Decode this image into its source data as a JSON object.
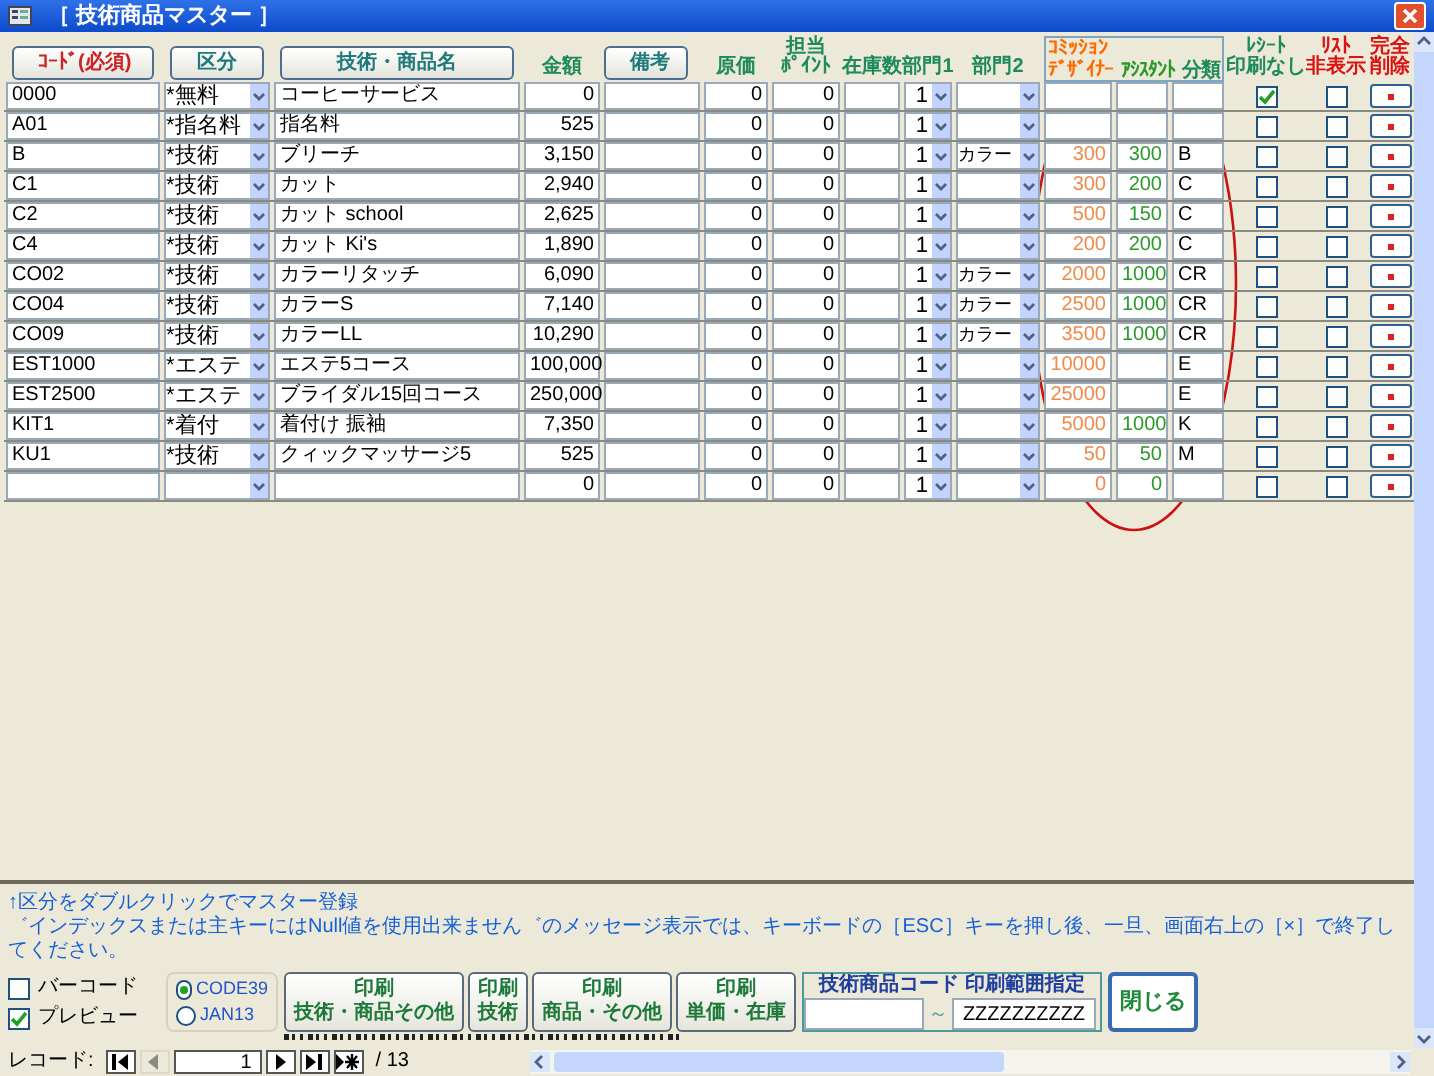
{
  "window": {
    "title": "［ 技術商品マスター ］"
  },
  "columns": [
    {
      "kind": "button",
      "lines": [
        "ｺｰﾄﾞ(必須)"
      ],
      "color": "#cc2222"
    },
    {
      "kind": "button",
      "lines": [
        "区分"
      ],
      "color": "#1f7a7a"
    },
    {
      "kind": "button",
      "lines": [
        "技術・商品名"
      ],
      "color": "#1f7a7a"
    },
    {
      "kind": "label",
      "lines": [
        "金額"
      ],
      "color": "#1f8a5a"
    },
    {
      "kind": "button",
      "lines": [
        "備考"
      ],
      "color": "#1f7a7a"
    },
    {
      "kind": "label",
      "lines": [
        "原価"
      ],
      "color": "#1f8a5a"
    },
    {
      "kind": "label",
      "lines": [
        "担当",
        "ﾎﾟｲﾝﾄ"
      ],
      "color": "#1f8a5a"
    },
    {
      "kind": "label",
      "lines": [
        "在庫数"
      ],
      "color": "#1f8a5a"
    },
    {
      "kind": "label",
      "lines": [
        "部門1"
      ],
      "color": "#1f8a5a"
    },
    {
      "kind": "label",
      "lines": [
        "部門2"
      ],
      "color": "#1f8a5a"
    },
    {
      "kind": "group",
      "lines": [
        "ｺﾐｯｼｮﾝ"
      ],
      "color": "#ff6a00",
      "children": [
        {
          "label": "ﾃﾞｻﾞｲﾅｰ",
          "color": "#ff6a00"
        },
        {
          "label": "ｱｼｽﾀﾝﾄ",
          "color": "#2a9a2a"
        },
        {
          "label": "分類",
          "color": "#1f8a5a"
        }
      ]
    },
    {
      "kind": "label",
      "lines": [
        "ﾚｼｰﾄ",
        "印刷なし"
      ],
      "color": "#1f8a5a"
    },
    {
      "kind": "label",
      "lines": [
        "ﾘｽﾄ",
        "非表示"
      ],
      "color": "#dd1111"
    },
    {
      "kind": "label",
      "lines": [
        "完全",
        "削除"
      ],
      "color": "#dd1111"
    }
  ],
  "rows": [
    {
      "code": "0000",
      "category": "*無料",
      "name": "コーヒーサービス",
      "amount": "0",
      "cost": "0",
      "points": "0",
      "dept1": "1",
      "no_receipt": true,
      "list_hidden": false
    },
    {
      "code": "A01",
      "category": "*指名料",
      "name": "指名料",
      "amount": "525",
      "cost": "0",
      "points": "0",
      "dept1": "1",
      "no_receipt": false,
      "list_hidden": false
    },
    {
      "code": "B",
      "category": "*技術",
      "name": "ブリーチ",
      "amount": "3,150",
      "cost": "0",
      "points": "0",
      "dept1": "1",
      "dept2": "カラー",
      "designer": "300",
      "assistant": "300",
      "class": "B",
      "no_receipt": false,
      "list_hidden": false
    },
    {
      "code": "C1",
      "category": "*技術",
      "name": "カット",
      "amount": "2,940",
      "cost": "0",
      "points": "0",
      "dept1": "1",
      "designer": "300",
      "assistant": "200",
      "class": "C",
      "no_receipt": false,
      "list_hidden": false
    },
    {
      "code": "C2",
      "category": "*技術",
      "name": "カット school",
      "amount": "2,625",
      "cost": "0",
      "points": "0",
      "dept1": "1",
      "designer": "500",
      "assistant": "150",
      "class": "C",
      "no_receipt": false,
      "list_hidden": false
    },
    {
      "code": "C4",
      "category": "*技術",
      "name": "カット Ki's",
      "amount": "1,890",
      "cost": "0",
      "points": "0",
      "dept1": "1",
      "designer": "200",
      "assistant": "200",
      "class": "C",
      "no_receipt": false,
      "list_hidden": false
    },
    {
      "code": "CO02",
      "category": "*技術",
      "name": "カラーリタッチ",
      "amount": "6,090",
      "cost": "0",
      "points": "0",
      "dept1": "1",
      "dept2": "カラー",
      "designer": "2000",
      "assistant": "1000",
      "class": "CR",
      "no_receipt": false,
      "list_hidden": false
    },
    {
      "code": "CO04",
      "category": "*技術",
      "name": "カラーS",
      "amount": "7,140",
      "cost": "0",
      "points": "0",
      "dept1": "1",
      "dept2": "カラー",
      "designer": "2500",
      "assistant": "1000",
      "class": "CR",
      "no_receipt": false,
      "list_hidden": false
    },
    {
      "code": "CO09",
      "category": "*技術",
      "name": "カラーLL",
      "amount": "10,290",
      "cost": "0",
      "points": "0",
      "dept1": "1",
      "dept2": "カラー",
      "designer": "3500",
      "assistant": "1000",
      "class": "CR",
      "no_receipt": false,
      "list_hidden": false
    },
    {
      "code": "EST1000",
      "category": "*エステ",
      "name": "エステ5コース",
      "amount": "100,000",
      "cost": "0",
      "points": "0",
      "dept1": "1",
      "designer": "10000",
      "class": "E",
      "no_receipt": false,
      "list_hidden": false
    },
    {
      "code": "EST2500",
      "category": "*エステ",
      "name": "ブライダル15回コース",
      "amount": "250,000",
      "cost": "0",
      "points": "0",
      "dept1": "1",
      "designer": "25000",
      "class": "E",
      "no_receipt": false,
      "list_hidden": false
    },
    {
      "code": "KIT1",
      "category": "*着付",
      "name": "着付け 振袖",
      "amount": "7,350",
      "cost": "0",
      "points": "0",
      "dept1": "1",
      "designer": "5000",
      "assistant": "1000",
      "class": "K",
      "no_receipt": false,
      "list_hidden": false
    },
    {
      "code": "KU1",
      "category": "*技術",
      "name": "クィックマッサージ5",
      "amount": "525",
      "cost": "0",
      "points": "0",
      "dept1": "1",
      "designer": "50",
      "assistant": "50",
      "class": "M",
      "no_receipt": false,
      "list_hidden": false
    },
    {
      "amount": "0",
      "cost": "0",
      "points": "0",
      "dept1": "1",
      "designer": "0",
      "assistant": "0",
      "no_receipt": false,
      "list_hidden": false
    }
  ],
  "hint": "↑区分をダブルクリックでマスター登録",
  "note": "゛インデックスまたは主キーにはNull値を使用出来ません゛のメッセージ表示では、キーボードの［ESC］キーを押し後、一旦、画面右上の［×］で終了してください。",
  "options": [
    {
      "label": "バーコード",
      "checked": false
    },
    {
      "label": "プレビュー",
      "checked": true
    }
  ],
  "barcode_types": [
    {
      "label": "CODE39",
      "selected": true
    },
    {
      "label": "JAN13",
      "selected": false
    }
  ],
  "print_buttons": [
    {
      "lines": [
        "印刷",
        "技術・商品その他"
      ]
    },
    {
      "lines": [
        "印刷",
        "技術"
      ]
    },
    {
      "lines": [
        "印刷",
        "商品・その他"
      ]
    },
    {
      "lines": [
        "印刷",
        "単価・在庫"
      ]
    }
  ],
  "range": {
    "title": "技術商品コード 印刷範囲指定",
    "separator": "～",
    "to": "ZZZZZZZZZZ"
  },
  "close_button": "閉じる",
  "navigator": {
    "label": "レコード:",
    "current": "1",
    "total": "/ 13",
    "buttons_before": [
      {
        "kind": "first",
        "disabled": false
      },
      {
        "kind": "prev",
        "disabled": true
      }
    ],
    "buttons_after": [
      {
        "kind": "next",
        "disabled": false
      },
      {
        "kind": "last",
        "disabled": false
      },
      {
        "kind": "new",
        "disabled": false
      }
    ]
  }
}
